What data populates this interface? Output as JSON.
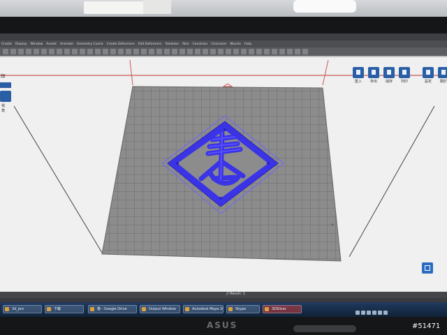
{
  "menu": {
    "items": [
      "Create",
      "Display",
      "Window",
      "Assets",
      "Animate",
      "Geometry Cache",
      "Create Deformers",
      "Edit Deformers",
      "Skeleton",
      "Skin",
      "Constrain",
      "Character",
      "Muscle",
      "Help"
    ]
  },
  "right_toolbar": [
    {
      "label": "匯入",
      "icon": "import-icon"
    },
    {
      "label": "存出",
      "icon": "export-icon"
    },
    {
      "label": "儲存",
      "icon": "save-icon"
    },
    {
      "label": "列印",
      "icon": "print-icon"
    },
    {
      "label": "設定",
      "icon": "settings-icon"
    },
    {
      "label": "關於",
      "icon": "about-icon"
    }
  ],
  "left_toolbar": {
    "label": "視角"
  },
  "status": {
    "result": "// Result: 1"
  },
  "taskbar": {
    "tasks": [
      {
        "label": "3d_pro",
        "active": false
      },
      {
        "label": "下載",
        "active": false
      },
      {
        "label": "春 - Google Drive",
        "active": false
      },
      {
        "label": "Output Window",
        "active": false
      },
      {
        "label": "Autodesk Maya 20...",
        "active": false
      },
      {
        "label": "Skype",
        "active": false
      },
      {
        "label": "3DSlicer",
        "active": true
      }
    ]
  },
  "model": {
    "character": "春",
    "color": "#3b34e6"
  },
  "monitor": {
    "brand": "ASUS"
  },
  "watermark": {
    "text": "#51471"
  }
}
